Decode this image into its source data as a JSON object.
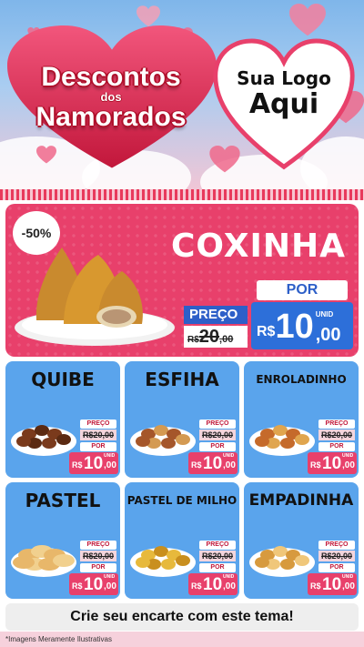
{
  "header": {
    "title_line1": "Descontos",
    "title_line2": "dos",
    "title_line3": "Namorados",
    "logo_line1": "Sua Logo",
    "logo_line2": "Aqui"
  },
  "featured": {
    "discount": "-50%",
    "name": "COXINHA",
    "preco_label": "PREÇO",
    "old_currency": "R$",
    "old_int": "20",
    "old_dec": ",00",
    "por_label": "POR",
    "unid": "UNID",
    "new_currency": "R$",
    "new_int": "10",
    "new_dec": ",00"
  },
  "cards": [
    {
      "name": "QUIBE",
      "preco": "PREÇO",
      "old": "R$20,00",
      "por": "POR",
      "unid": "UNID",
      "cur": "R$",
      "int": "10",
      "dec": ",00"
    },
    {
      "name": "ESFIHA",
      "preco": "PREÇO",
      "old": "R$20,00",
      "por": "POR",
      "unid": "UNID",
      "cur": "R$",
      "int": "10",
      "dec": ",00"
    },
    {
      "name": "ENROLADINHO",
      "preco": "PREÇO",
      "old": "R$20,00",
      "por": "POR",
      "unid": "UNID",
      "cur": "R$",
      "int": "10",
      "dec": ",00"
    },
    {
      "name": "PASTEL",
      "preco": "PREÇO",
      "old": "R$20,00",
      "por": "POR",
      "unid": "UNID",
      "cur": "R$",
      "int": "10",
      "dec": ",00"
    },
    {
      "name": "PASTEL DE MILHO",
      "preco": "PREÇO",
      "old": "R$20,00",
      "por": "POR",
      "unid": "UNID",
      "cur": "R$",
      "int": "10",
      "dec": ",00"
    },
    {
      "name": "EMPADINHA",
      "preco": "PREÇO",
      "old": "R$20,00",
      "por": "POR",
      "unid": "UNID",
      "cur": "R$",
      "int": "10",
      "dec": ",00"
    }
  ],
  "footer": {
    "cta": "Crie seu encarte com este tema!",
    "disclaimer": "*Imagens Meramente Ilustrativas"
  },
  "colors": {
    "pink": "#e8406b",
    "blue": "#5aa4ec",
    "price_blue": "#2d6fd9"
  }
}
